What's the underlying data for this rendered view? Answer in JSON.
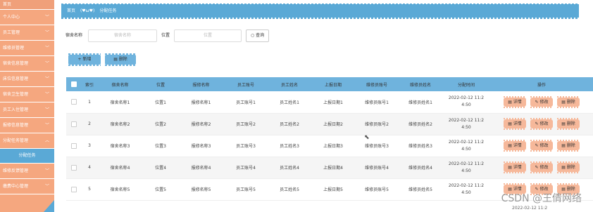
{
  "sidebar": {
    "home": "首页",
    "items": [
      {
        "label": "个人中心"
      },
      {
        "label": "员工管理"
      },
      {
        "label": "维修员管理"
      },
      {
        "label": "宿舍信息管理"
      },
      {
        "label": "床位信息管理"
      },
      {
        "label": "宿舍卫生管理"
      },
      {
        "label": "员工入住管理"
      },
      {
        "label": "报修信息管理"
      },
      {
        "label": "分配任务管理"
      }
    ],
    "active_sub": "分配任务",
    "items_after": [
      {
        "label": "维修反馈管理"
      },
      {
        "label": "缴费中心管理"
      }
    ]
  },
  "breadcrumb": {
    "home": "首页",
    "icon": "(♥ω♥)",
    "current": "分配任务"
  },
  "search": {
    "label1": "宿舍名称",
    "placeholder1": "宿舍名称",
    "label2": "位置",
    "placeholder2": "位置",
    "button": "查询"
  },
  "actions": {
    "add": "+ 新增",
    "delete": "删除"
  },
  "table": {
    "headers": [
      "索引",
      "宿舍名称",
      "位置",
      "报修名称",
      "员工账号",
      "员工姓名",
      "上报日期",
      "维修员账号",
      "维修员姓名",
      "分配时间",
      "操作"
    ],
    "rows": [
      {
        "idx": "1",
        "dorm": "宿舍名称1",
        "loc": "位置1",
        "repair": "报修名称1",
        "acct": "员工账号1",
        "name": "员工姓名1",
        "date": "上报日期1",
        "racct": "维修员账号1",
        "rname": "维修员姓名1",
        "time1": "2022-02-12 11:2",
        "time2": "4:50"
      },
      {
        "idx": "2",
        "dorm": "宿舍名称2",
        "loc": "位置2",
        "repair": "报修名称2",
        "acct": "员工账号2",
        "name": "员工姓名2",
        "date": "上报日期2",
        "racct": "维修员账号2",
        "rname": "维修员姓名2",
        "time1": "2022-02-12 11:2",
        "time2": "4:50"
      },
      {
        "idx": "3",
        "dorm": "宿舍名称3",
        "loc": "位置3",
        "repair": "报修名称3",
        "acct": "员工账号3",
        "name": "员工姓名3",
        "date": "上报日期3",
        "racct": "维修员账号3",
        "rname": "维修员姓名3",
        "time1": "2022-02-12 11:2",
        "time2": "4:50"
      },
      {
        "idx": "4",
        "dorm": "宿舍名称4",
        "loc": "位置4",
        "repair": "报修名称4",
        "acct": "员工账号4",
        "name": "员工姓名4",
        "date": "上报日期4",
        "racct": "维修员账号4",
        "rname": "维修员姓名4",
        "time1": "2022-02-12 11:2",
        "time2": "4:50"
      },
      {
        "idx": "5",
        "dorm": "宿舍名称5",
        "loc": "位置5",
        "repair": "报修名称5",
        "acct": "员工账号5",
        "name": "员工姓名5",
        "date": "上报日期5",
        "racct": "维修员账号5",
        "rname": "维修员姓名5",
        "time1": "2022-02-12 11:2",
        "time2": "4:50"
      }
    ],
    "ops": {
      "detail": "详情",
      "edit": "修改",
      "delete": "删除"
    },
    "partial_next": "2022-02-12 11:2"
  },
  "watermark": "CSDN @王倩网络"
}
